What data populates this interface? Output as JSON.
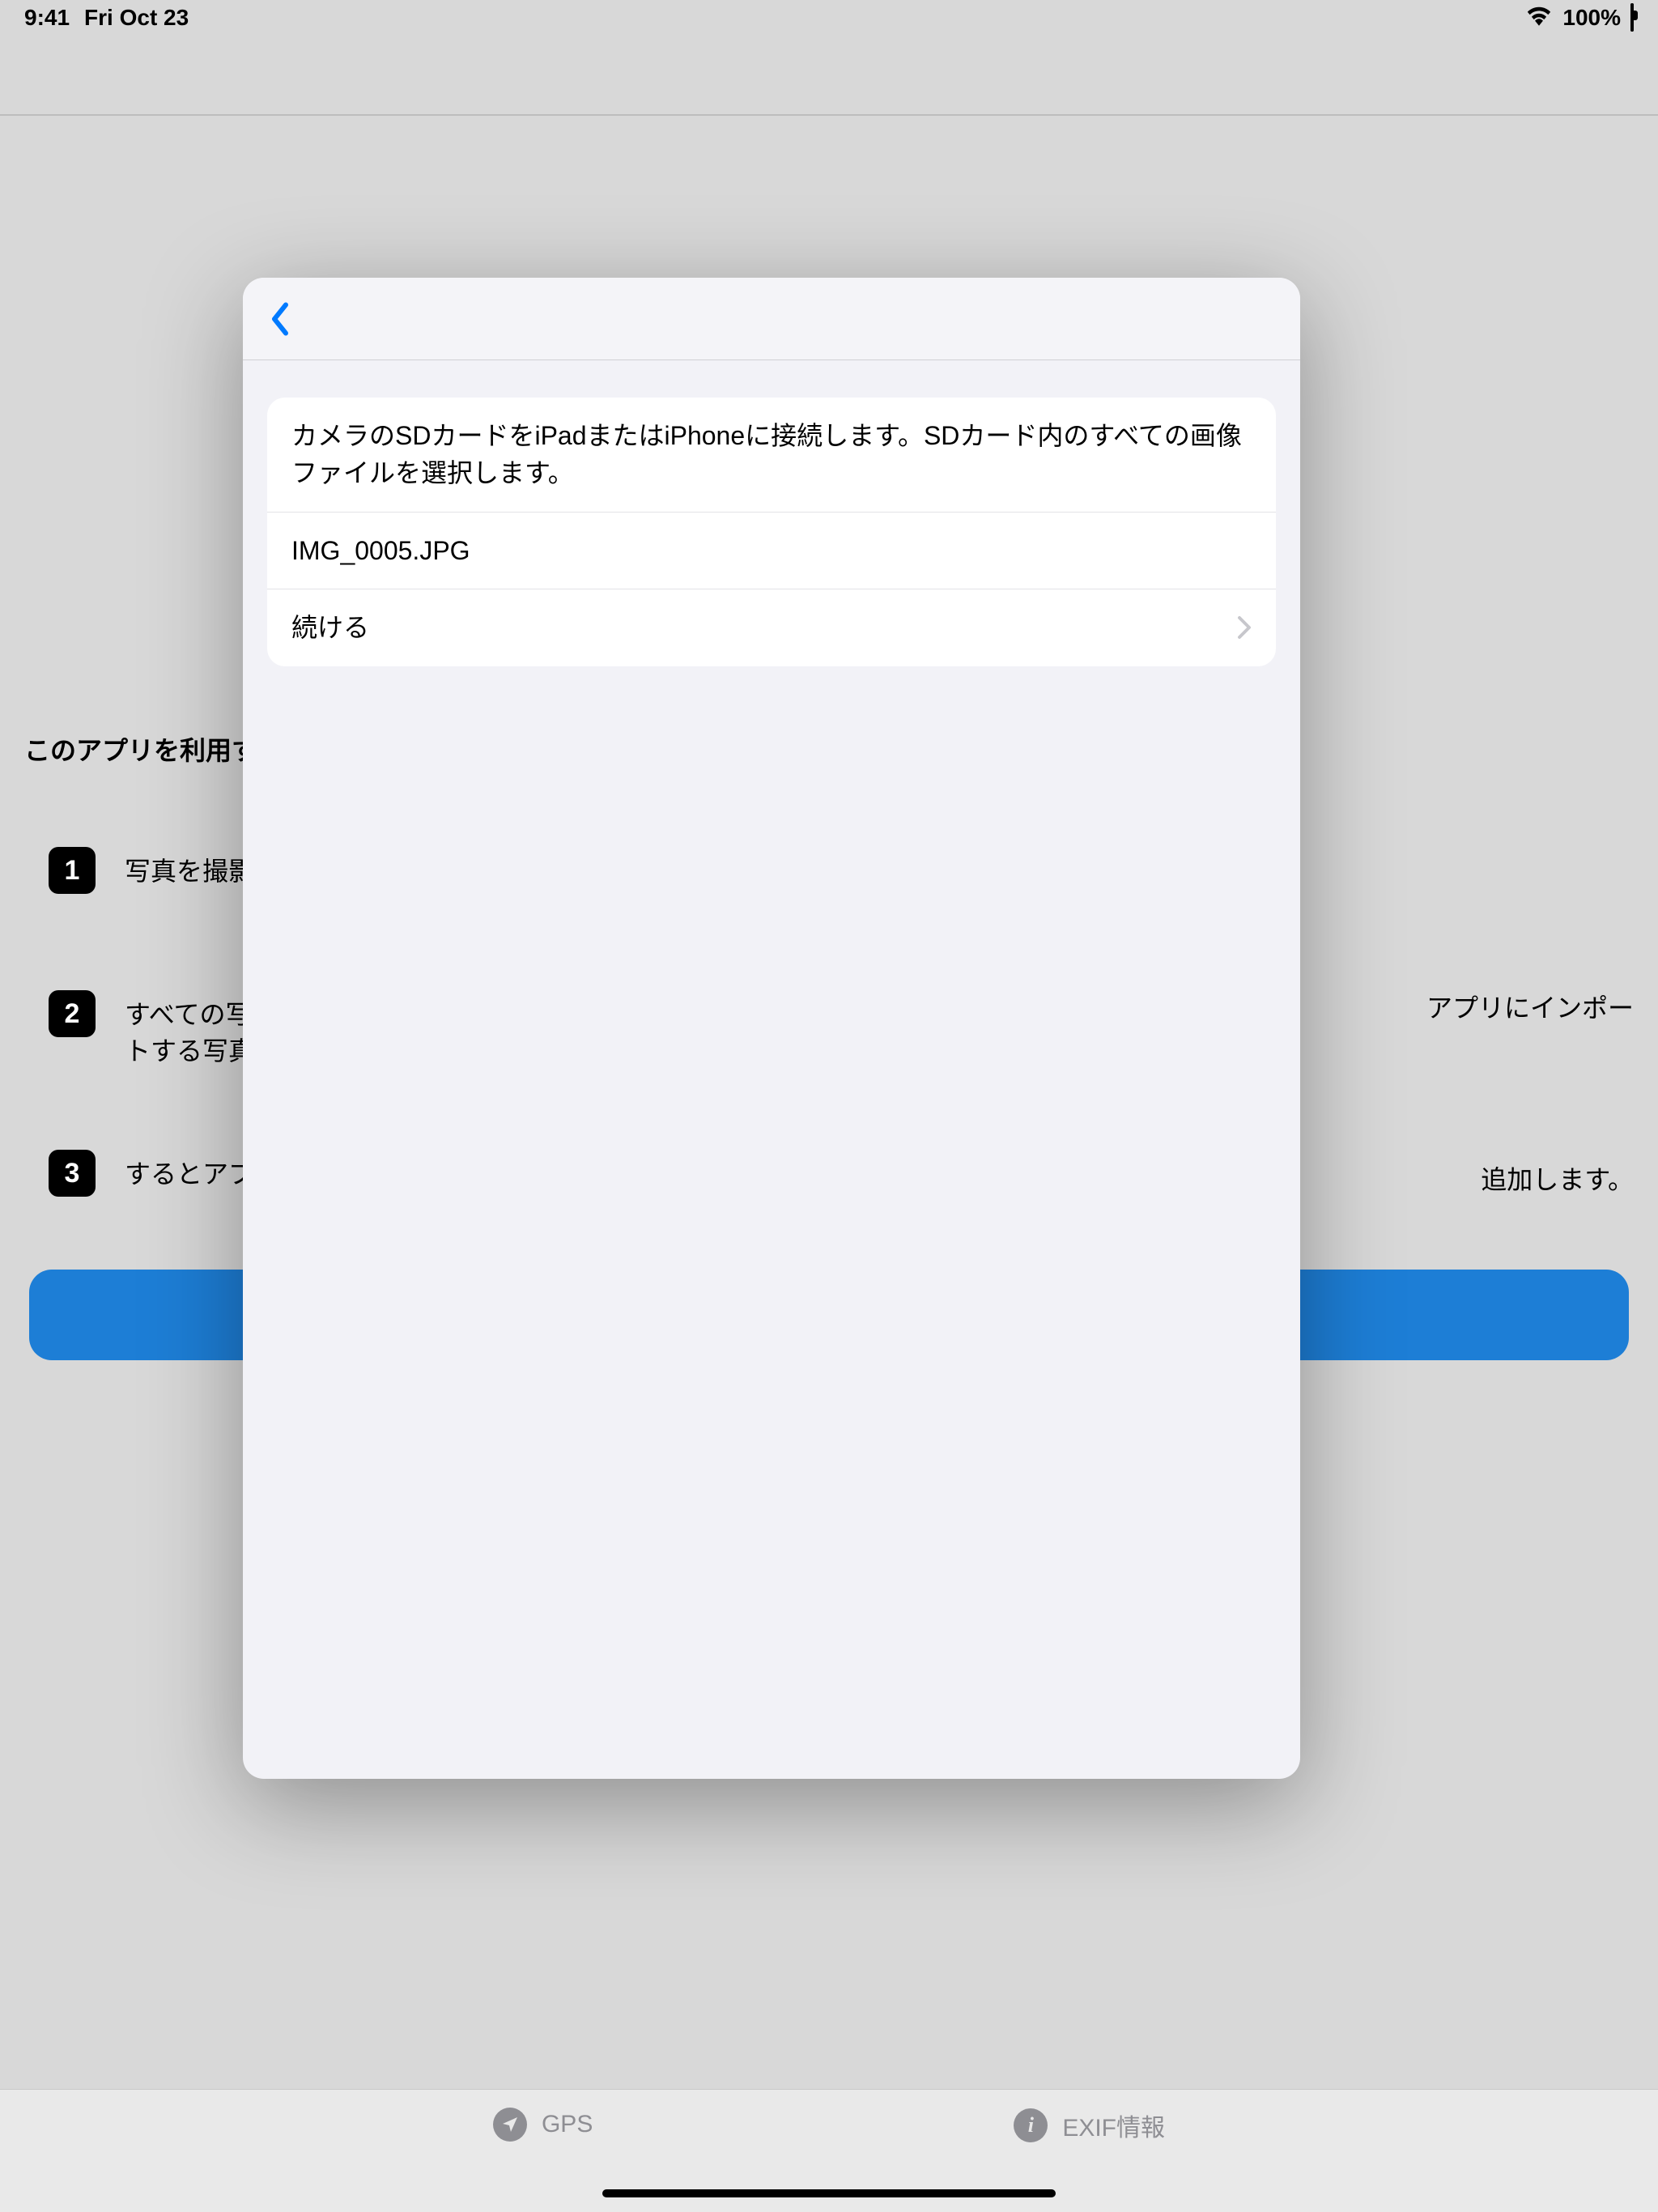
{
  "status": {
    "time": "9:41",
    "date": "Fri Oct 23",
    "battery": "100%"
  },
  "background": {
    "heading": "このアプリを利用す",
    "steps": {
      "s1": "写真を撮影",
      "s2_left_a": "すべての写",
      "s2_left_b": "トする写真",
      "s2_right": "アプリにインポー",
      "s3_left": "するとアプ",
      "s3_right": "追加します。"
    }
  },
  "modal": {
    "instruction": "カメラのSDカードをiPadまたはiPhoneに接続します。SDカード内のすべての画像ファイルを選択します。",
    "filename": "IMG_0005.JPG",
    "continue": "続ける"
  },
  "tabs": {
    "gps": "GPS",
    "exif": "EXIF情報"
  }
}
